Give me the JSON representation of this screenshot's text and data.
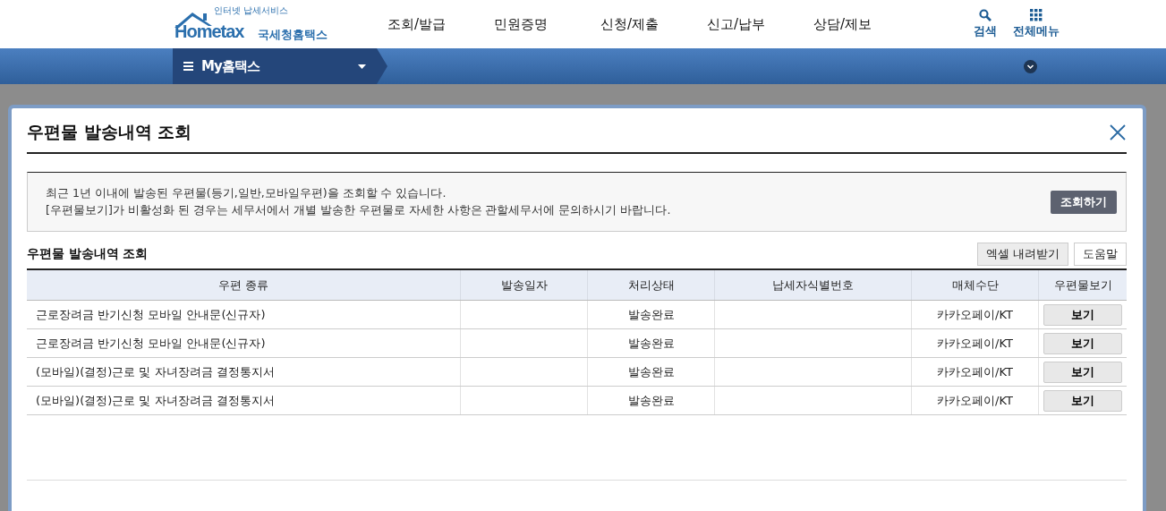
{
  "header": {
    "logo": {
      "tagline": "인터넷 납세서비스",
      "wordmark": "Hometax",
      "label": "국세청홈택스"
    },
    "nav": [
      "조회/발급",
      "민원증명",
      "신청/제출",
      "신고/납부",
      "상담/제보"
    ],
    "actions": [
      {
        "kind": "search",
        "label": "검색"
      },
      {
        "kind": "grid",
        "label": "전체메뉴"
      }
    ]
  },
  "subnav": {
    "label": "My홈택스"
  },
  "modal": {
    "title": "우편물 발송내역 조회",
    "notices": [
      "최근 1년 이내에 발송된 우편물(등기,일반,모바일우편)을 조회할 수 있습니다.",
      "[우편물보기]가 비활성화 된 경우는 세무서에서 개별 발송한 우편물로 자세한 사항은 관할세무서에 문의하시기 바랍니다."
    ],
    "search_button": "조회하기",
    "section_title": "우편물 발송내역 조회",
    "tools": [
      "엑셀 내려받기",
      "도움말"
    ],
    "table": {
      "columns": [
        "우편 종류",
        "발송일자",
        "처리상태",
        "납세자식별번호",
        "매체수단",
        "우편물보기"
      ],
      "rows": [
        {
          "category": "근로장려금 반기신청 모바일 안내문(신규자)",
          "status": "발송완료",
          "medium": "카카오페이/KT",
          "action": "보기"
        },
        {
          "category": "근로장려금 반기신청 모바일 안내문(신규자)",
          "status": "발송완료",
          "medium": "카카오페이/KT",
          "action": "보기"
        },
        {
          "category": "(모바일)(결정)근로 및 자녀장려금 결정통지서",
          "status": "발송완료",
          "medium": "카카오페이/KT",
          "action": "보기"
        },
        {
          "category": "(모바일)(결정)근로 및 자녀장려금 결정통지서",
          "status": "발송완료",
          "medium": "카카오페이/KT",
          "action": "보기"
        }
      ]
    }
  }
}
